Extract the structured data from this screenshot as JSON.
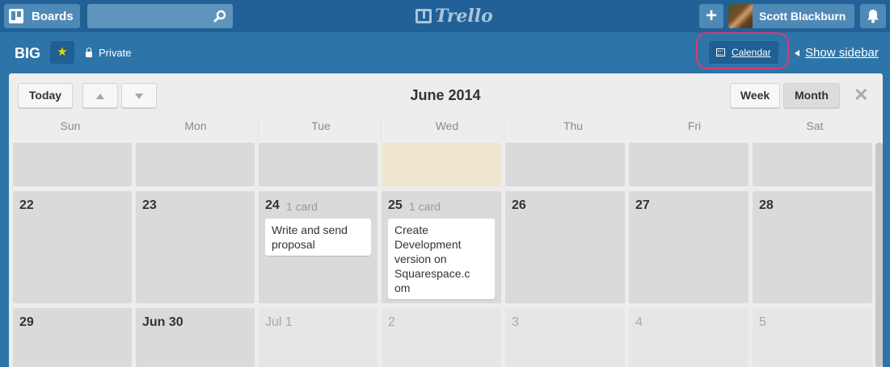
{
  "topbar": {
    "boards_label": "Boards",
    "logo_text": "Trello",
    "add_label": "+",
    "user_name": "Scott Blackburn"
  },
  "board": {
    "name": "BIG",
    "visibility": "Private",
    "calendar_label": "Calendar",
    "show_sidebar_label": "Show sidebar"
  },
  "calendar": {
    "today_label": "Today",
    "title": "June 2014",
    "week_label": "Week",
    "month_label": "Month",
    "close_label": "✕",
    "weekdays": [
      "Sun",
      "Mon",
      "Tue",
      "Wed",
      "Thu",
      "Fri",
      "Sat"
    ],
    "row1": [
      {
        "num": "22"
      },
      {
        "num": "23"
      },
      {
        "num": "24",
        "count": "1 card",
        "card": "Write and send proposal"
      },
      {
        "num": "25",
        "count": "1 card",
        "card": "Create Development version on Squarespace.c om"
      },
      {
        "num": "26"
      },
      {
        "num": "27"
      },
      {
        "num": "28"
      }
    ],
    "row2": [
      {
        "num": "29"
      },
      {
        "num": "Jun 30"
      },
      {
        "num": "Jul 1"
      },
      {
        "num": "2"
      },
      {
        "num": "3"
      },
      {
        "num": "4"
      },
      {
        "num": "5"
      }
    ]
  },
  "colors": {
    "topbar": "#216197",
    "board_bg": "#2d75a8",
    "highlight_ring": "#e0367a",
    "today_cell": "#eee6cf"
  }
}
